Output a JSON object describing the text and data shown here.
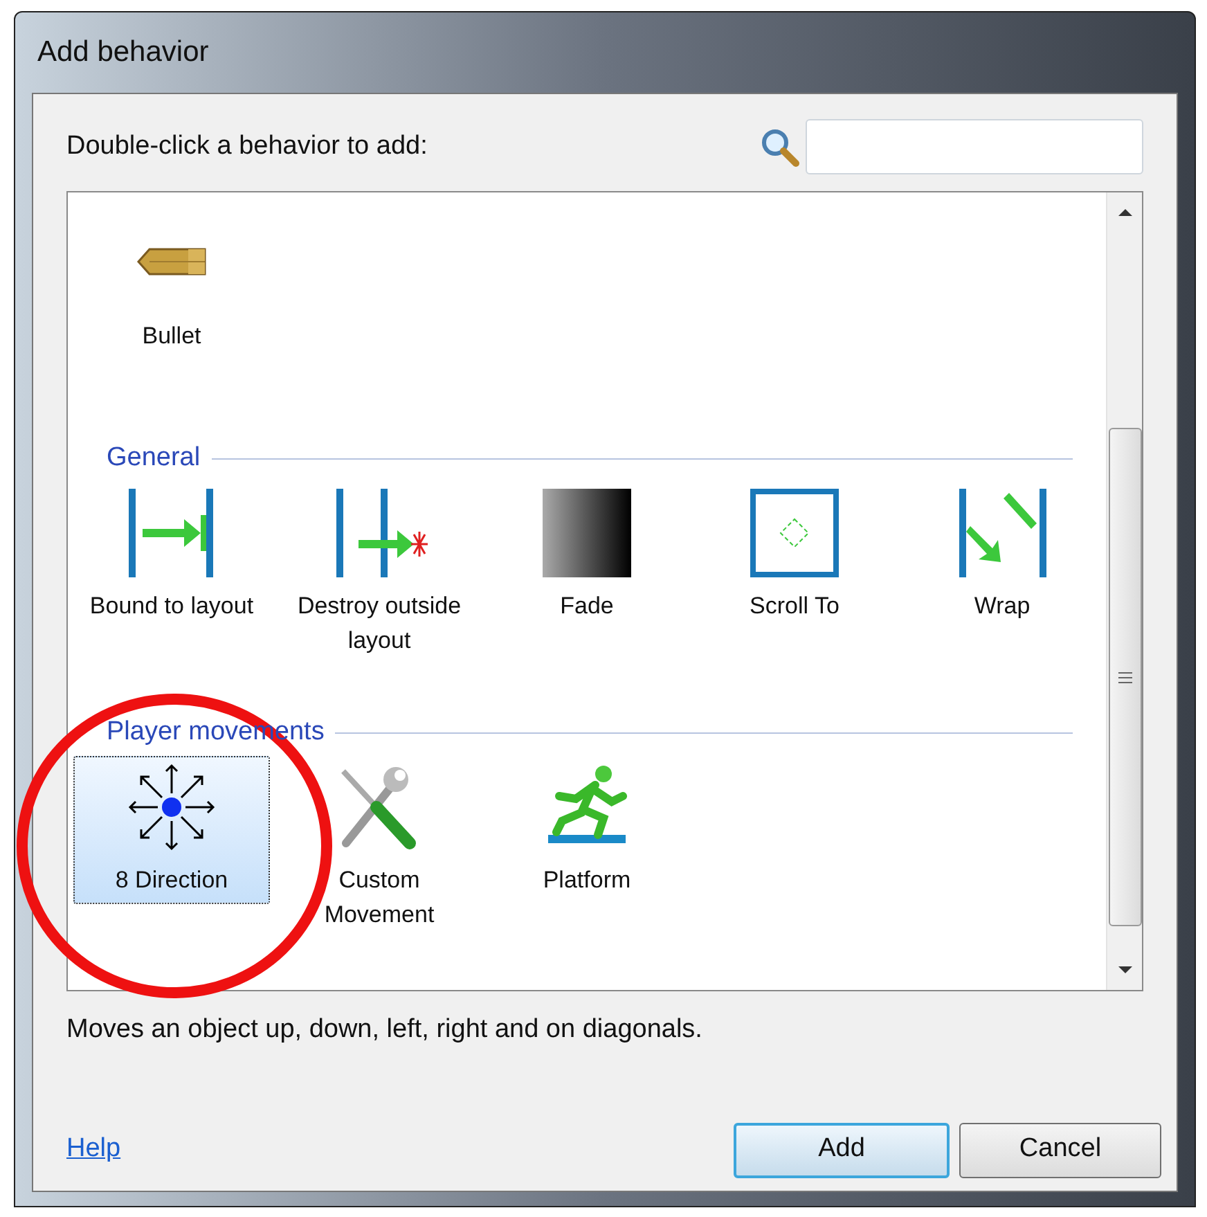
{
  "window": {
    "title": "Add behavior"
  },
  "prompt": "Double-click a behavior to add:",
  "categories": [
    {
      "items": [
        {
          "label": "Bullet",
          "kind": "bullet",
          "selected": false
        }
      ]
    },
    {
      "title": "General",
      "items": [
        {
          "label": "Bound to layout",
          "kind": "bound",
          "selected": false
        },
        {
          "label": "Destroy outside layout",
          "kind": "destroy",
          "selected": false
        },
        {
          "label": "Fade",
          "kind": "fade",
          "selected": false
        },
        {
          "label": "Scroll To",
          "kind": "scroll",
          "selected": false
        },
        {
          "label": "Wrap",
          "kind": "wrap",
          "selected": false
        }
      ]
    },
    {
      "title": "Player movements",
      "items": [
        {
          "label": "8 Direction",
          "kind": "eight",
          "selected": true
        },
        {
          "label": "Custom Movement",
          "kind": "tools",
          "selected": false
        },
        {
          "label": "Platform",
          "kind": "runner",
          "selected": false
        }
      ]
    }
  ],
  "description": "Moves an object up, down, left, right and on diagonals.",
  "help_link": "Help",
  "buttons": [
    {
      "label": "Add",
      "kind": "default"
    },
    {
      "label": "Cancel",
      "kind": "normal"
    }
  ],
  "annotations": [
    {
      "kind": "circle"
    }
  ]
}
